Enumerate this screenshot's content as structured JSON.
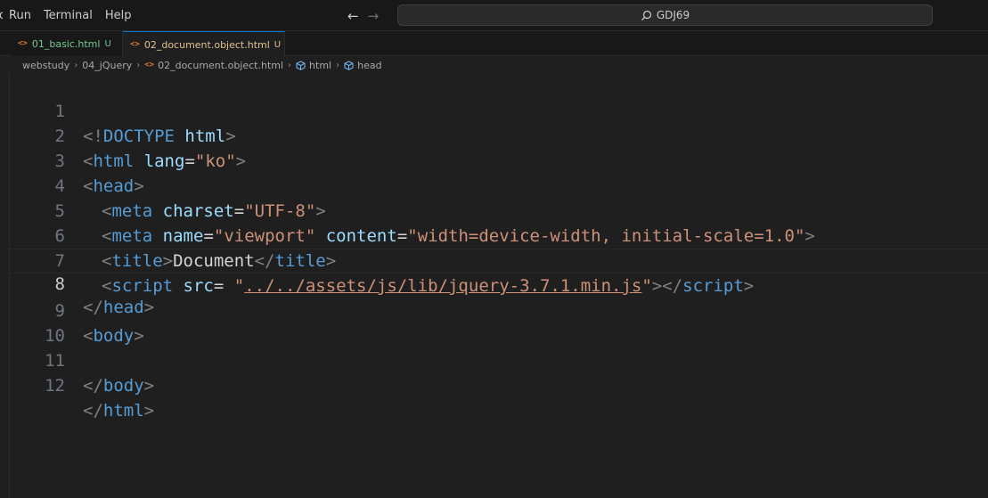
{
  "menu": {
    "clipped_label": "o",
    "items": [
      "Run",
      "Terminal",
      "Help"
    ]
  },
  "nav": {
    "back": "←",
    "forward": "→"
  },
  "command_center": {
    "text": "GDJ69"
  },
  "tabs": [
    {
      "name": "01_basic.html",
      "flag": "U",
      "active": false
    },
    {
      "name": "02_document.object.html",
      "flag": "U",
      "active": true,
      "modified": true
    }
  ],
  "breadcrumb": {
    "parts": [
      "webstudy",
      "04_jQuery",
      "02_document.object.html",
      "html",
      "head"
    ]
  },
  "editor": {
    "current_line": 8,
    "line_numbers": [
      "1",
      "2",
      "3",
      "4",
      "5",
      "6",
      "7",
      "8",
      "9",
      "10",
      "11",
      "12"
    ],
    "code": {
      "l1": {
        "lt": "<!",
        "doctype": "DOCTYPE",
        "html": "html",
        "gt": ">"
      },
      "l2": {
        "tag": "html",
        "attr": "lang",
        "val": "\"ko\""
      },
      "l3": {
        "tag": "head"
      },
      "l4": {
        "tag": "meta",
        "attr": "charset",
        "val": "\"UTF-8\""
      },
      "l5": {
        "tag": "meta",
        "attr1": "name",
        "val1": "\"viewport\"",
        "attr2": "content",
        "val2": "\"width=device-width, initial-scale=1.0\""
      },
      "l6": {
        "tag": "title",
        "text": "Document"
      },
      "l7": {
        "tag": "script",
        "attr": "src",
        "q": "\"",
        "path": "../../assets/js/lib/jquery-3.7.1.min.js"
      },
      "l8": {
        "tag": "head"
      },
      "l9": {
        "tag": "body"
      },
      "l11": {
        "tag": "body"
      },
      "l12": {
        "tag": "html"
      }
    }
  },
  "colors": {
    "tag": "#569cd6",
    "attribute": "#9cdcfe",
    "string": "#ce9178",
    "bracket": "#808080",
    "untracked": "#73c991",
    "modified": "#e2c08d",
    "accent": "#0078d4",
    "file_icon": "#e37933"
  }
}
